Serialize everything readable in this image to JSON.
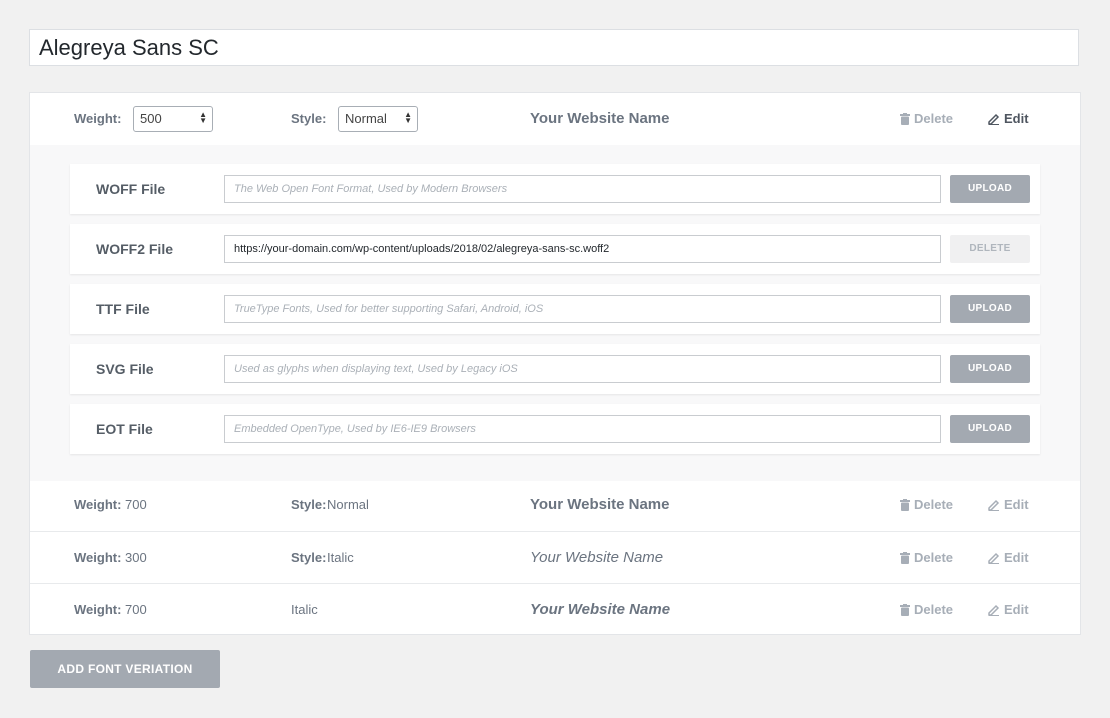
{
  "font_name": "Alegreya Sans SC",
  "editing": {
    "weight_label": "Weight:",
    "weight_value": "500",
    "style_label": "Style:",
    "style_value": "Normal",
    "preview": "Your Website Name",
    "delete_label": "Delete",
    "edit_label": "Edit"
  },
  "files": [
    {
      "label": "WOFF File",
      "value": "",
      "placeholder": "The Web Open Font Format, Used by Modern Browsers",
      "button": "UPLOAD"
    },
    {
      "label": "WOFF2 File",
      "value": "https://your-domain.com/wp-content/uploads/2018/02/alegreya-sans-sc.woff2",
      "placeholder": "",
      "button": "DELETE"
    },
    {
      "label": "TTF File",
      "value": "",
      "placeholder": "TrueType Fonts, Used for better supporting Safari, Android, iOS",
      "button": "UPLOAD"
    },
    {
      "label": "SVG File",
      "value": "",
      "placeholder": "Used as glyphs when displaying text, Used by Legacy iOS",
      "button": "UPLOAD"
    },
    {
      "label": "EOT File",
      "value": "",
      "placeholder": "Embedded OpenType, Used by IE6-IE9 Browsers",
      "button": "UPLOAD"
    }
  ],
  "variations": [
    {
      "weight_label": "Weight:",
      "weight": "700",
      "style_label": "Style:",
      "style": "Normal",
      "preview": "Your Website Name",
      "delete_label": "Delete",
      "edit_label": "Edit"
    },
    {
      "weight_label": "Weight:",
      "weight": "300",
      "style_label": "Style:",
      "style": "Italic",
      "preview": "Your Website Name",
      "delete_label": "Delete",
      "edit_label": "Edit"
    },
    {
      "weight_label": "Weight:",
      "weight": "700",
      "style_label": "",
      "style": "Italic",
      "preview": "Your Website Name",
      "delete_label": "Delete",
      "edit_label": "Edit"
    }
  ],
  "add_button_label": "ADD FONT VERIATION"
}
